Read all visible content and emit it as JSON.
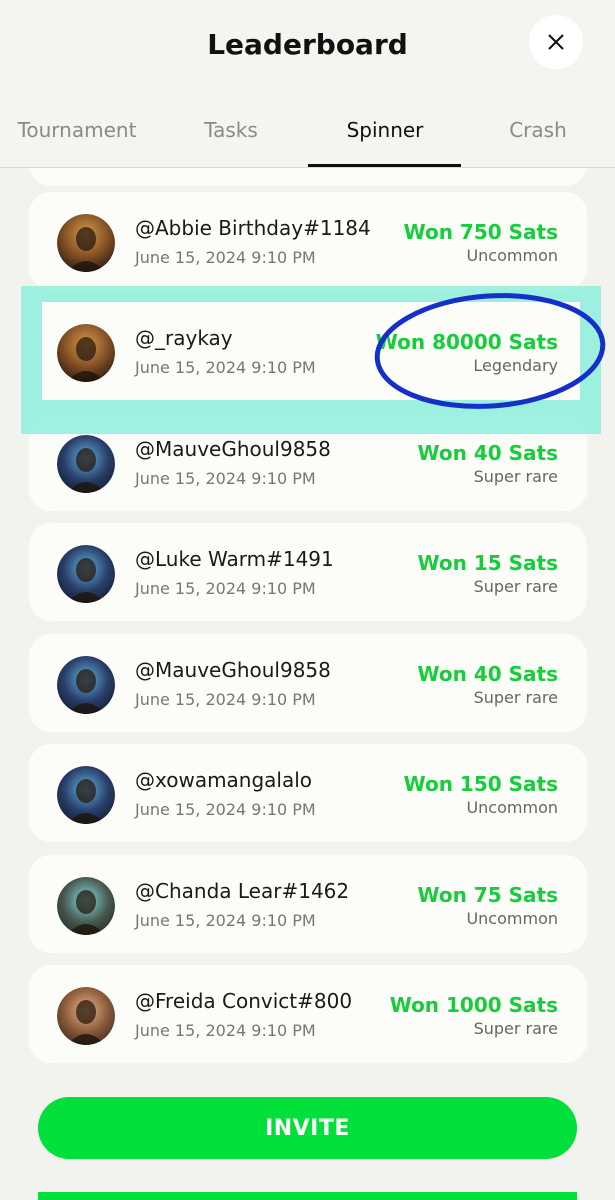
{
  "header": {
    "title": "Leaderboard"
  },
  "tabs": [
    {
      "label": "Tournament",
      "active": false
    },
    {
      "label": "Tasks",
      "active": false
    },
    {
      "label": "Spinner",
      "active": true
    },
    {
      "label": "Crash",
      "active": false
    }
  ],
  "entries": [
    {
      "user": "@Abbie Birthday#1184",
      "date": "June 15, 2024 9:10 PM",
      "won": "Won 750 Sats",
      "rarity": "Uncommon",
      "avatar": "avatar-a"
    },
    {
      "user": "@_raykay",
      "date": "June 15, 2024 9:10 PM",
      "won": "Won 80000 Sats",
      "rarity": "Legendary",
      "avatar": "avatar-a"
    },
    {
      "user": "@MauveGhoul9858",
      "date": "June 15, 2024 9:10 PM",
      "won": "Won 40 Sats",
      "rarity": "Super rare",
      "avatar": "avatar-b"
    },
    {
      "user": "@Luke Warm#1491",
      "date": "June 15, 2024 9:10 PM",
      "won": "Won 15 Sats",
      "rarity": "Super rare",
      "avatar": "avatar-b"
    },
    {
      "user": "@MauveGhoul9858",
      "date": "June 15, 2024 9:10 PM",
      "won": "Won 40 Sats",
      "rarity": "Super rare",
      "avatar": "avatar-b"
    },
    {
      "user": "@xowamangalalo",
      "date": "June 15, 2024 9:10 PM",
      "won": "Won 150 Sats",
      "rarity": "Uncommon",
      "avatar": "avatar-b"
    },
    {
      "user": "@Chanda Lear#1462",
      "date": "June 15, 2024 9:10 PM",
      "won": "Won 75 Sats",
      "rarity": "Uncommon",
      "avatar": "avatar-c"
    },
    {
      "user": "@Freida Convict#800",
      "date": "June 15, 2024 9:10 PM",
      "won": "Won 1000 Sats",
      "rarity": "Super rare",
      "avatar": "avatar-d"
    }
  ],
  "invite": {
    "label": "INVITE"
  },
  "colors": {
    "won_green": "#18cd3b",
    "invite_green": "#00df3a",
    "highlight": "#8ef0dd",
    "annotation_circle": "#1430c8"
  }
}
